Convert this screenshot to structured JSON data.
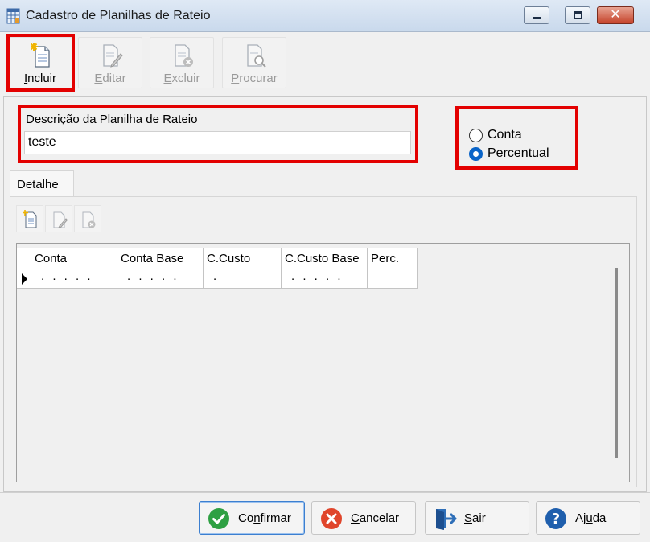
{
  "window": {
    "title": "Cadastro de Planilhas de Rateio",
    "close_glyph": "✕"
  },
  "toolbar": {
    "items": [
      {
        "label_first": "I",
        "label_rest": "ncluir",
        "enabled": true
      },
      {
        "label_first": "E",
        "label_rest": "ditar",
        "enabled": false
      },
      {
        "label_first": "E",
        "label_rest": "xcluir",
        "enabled": false
      },
      {
        "label_first": "P",
        "label_rest": "rocurar",
        "enabled": false
      }
    ]
  },
  "form": {
    "description_label": "Descrição da Planilha de Rateio",
    "description_value": "teste",
    "type_options": [
      {
        "label": "Conta",
        "checked": false
      },
      {
        "label": "Percentual",
        "checked": true
      }
    ]
  },
  "tabs": [
    {
      "label": "Detalhe",
      "active": true
    }
  ],
  "grid": {
    "columns": [
      "Conta",
      "Conta Base",
      "C.Custo",
      "C.Custo Base",
      "Perc."
    ],
    "rows": [
      [
        ". . . . .",
        ". . . . .",
        ".",
        ". . . . .",
        ""
      ]
    ]
  },
  "footer": {
    "confirm": {
      "pre": "Co",
      "u": "n",
      "post": "firmar"
    },
    "cancel": {
      "pre": "",
      "u": "C",
      "post": "ancelar"
    },
    "exit": {
      "pre": "",
      "u": "S",
      "post": "air"
    },
    "help": {
      "pre": "Aj",
      "u": "u",
      "post": "da"
    }
  },
  "colors": {
    "highlight_box": "#e30000",
    "confirm_icon": "#2ea043",
    "cancel_icon": "#e0452b",
    "exit_icon": "#2f6fb8",
    "help_icon": "#1f5fad",
    "radio_selected": "#0a64c8"
  },
  "icons": {
    "app": "spreadsheet-icon",
    "include": "new-document-icon",
    "edit": "edit-document-icon",
    "delete": "delete-document-icon",
    "search": "search-document-icon",
    "confirm": "check-circle-icon",
    "cancel": "x-circle-icon",
    "exit": "exit-door-icon",
    "help": "question-circle-icon"
  }
}
